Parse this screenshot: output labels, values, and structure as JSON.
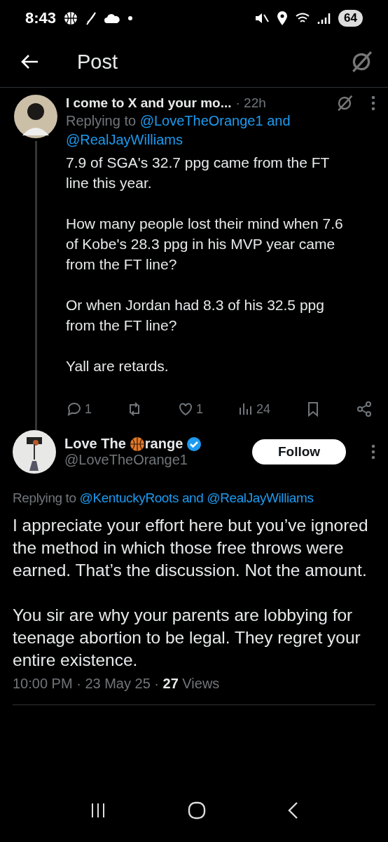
{
  "status_bar": {
    "time": "8:43",
    "battery": "64"
  },
  "header": {
    "title": "Post"
  },
  "parent_post": {
    "author": "I come to X and your mo...",
    "time": "· 22h",
    "replying_prefix": "Replying to",
    "replying_to": "@LoveTheOrange1 and @RealJayWilliams",
    "paragraphs": [
      "7.9 of SGA's 32.7 ppg came from the FT line this year.",
      "How many people lost their mind when 7.6 of Kobe's 28.3 ppg in his MVP year came from the FT line?",
      "Or when Jordan had 8.3 of his 32.5 ppg from the FT line?",
      "Yall are retards."
    ],
    "actions": [
      {
        "kind": "reply",
        "count": "1"
      },
      {
        "kind": "repost"
      },
      {
        "kind": "like",
        "count": "1"
      },
      {
        "kind": "views",
        "count": "24"
      },
      {
        "kind": "bookmark"
      },
      {
        "kind": "share"
      }
    ]
  },
  "main_post": {
    "name_before": "Love The",
    "name_after": "range",
    "verified": true,
    "handle": "@LoveTheOrange1",
    "follow_label": "Follow",
    "replying_prefix": "Replying to",
    "replying_to": "@KentuckyRoots and @RealJayWilliams",
    "paragraphs": [
      "I appreciate your effort here but you’ve ignored the method in which those free throws were earned. That’s the discussion. Not the amount.",
      "You sir are why your parents are lobbying for teenage abortion to be legal. They regret your entire existence."
    ],
    "meta": "10:00 PM · 23 May 25 · **27** Views"
  }
}
